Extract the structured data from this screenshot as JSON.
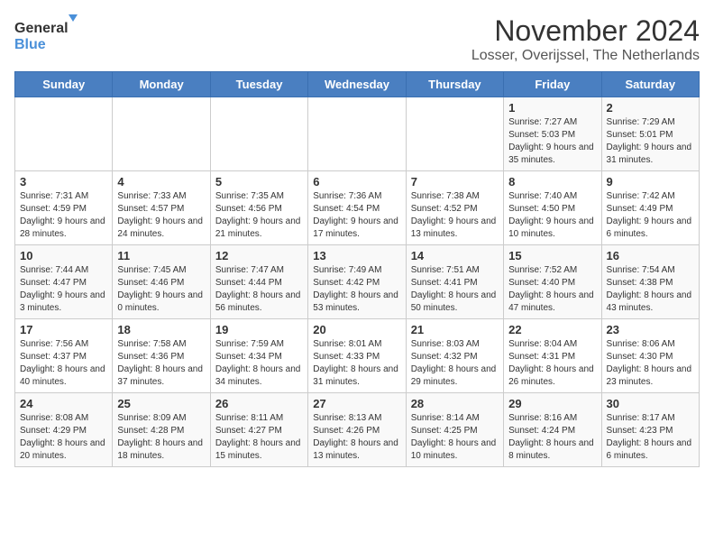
{
  "logo": {
    "line1": "General",
    "line2": "Blue"
  },
  "title": "November 2024",
  "subtitle": "Losser, Overijssel, The Netherlands",
  "headers": [
    "Sunday",
    "Monday",
    "Tuesday",
    "Wednesday",
    "Thursday",
    "Friday",
    "Saturday"
  ],
  "weeks": [
    [
      {
        "day": "",
        "info": ""
      },
      {
        "day": "",
        "info": ""
      },
      {
        "day": "",
        "info": ""
      },
      {
        "day": "",
        "info": ""
      },
      {
        "day": "",
        "info": ""
      },
      {
        "day": "1",
        "info": "Sunrise: 7:27 AM\nSunset: 5:03 PM\nDaylight: 9 hours\nand 35 minutes."
      },
      {
        "day": "2",
        "info": "Sunrise: 7:29 AM\nSunset: 5:01 PM\nDaylight: 9 hours\nand 31 minutes."
      }
    ],
    [
      {
        "day": "3",
        "info": "Sunrise: 7:31 AM\nSunset: 4:59 PM\nDaylight: 9 hours\nand 28 minutes."
      },
      {
        "day": "4",
        "info": "Sunrise: 7:33 AM\nSunset: 4:57 PM\nDaylight: 9 hours\nand 24 minutes."
      },
      {
        "day": "5",
        "info": "Sunrise: 7:35 AM\nSunset: 4:56 PM\nDaylight: 9 hours\nand 21 minutes."
      },
      {
        "day": "6",
        "info": "Sunrise: 7:36 AM\nSunset: 4:54 PM\nDaylight: 9 hours\nand 17 minutes."
      },
      {
        "day": "7",
        "info": "Sunrise: 7:38 AM\nSunset: 4:52 PM\nDaylight: 9 hours\nand 13 minutes."
      },
      {
        "day": "8",
        "info": "Sunrise: 7:40 AM\nSunset: 4:50 PM\nDaylight: 9 hours\nand 10 minutes."
      },
      {
        "day": "9",
        "info": "Sunrise: 7:42 AM\nSunset: 4:49 PM\nDaylight: 9 hours\nand 6 minutes."
      }
    ],
    [
      {
        "day": "10",
        "info": "Sunrise: 7:44 AM\nSunset: 4:47 PM\nDaylight: 9 hours\nand 3 minutes."
      },
      {
        "day": "11",
        "info": "Sunrise: 7:45 AM\nSunset: 4:46 PM\nDaylight: 9 hours\nand 0 minutes."
      },
      {
        "day": "12",
        "info": "Sunrise: 7:47 AM\nSunset: 4:44 PM\nDaylight: 8 hours\nand 56 minutes."
      },
      {
        "day": "13",
        "info": "Sunrise: 7:49 AM\nSunset: 4:42 PM\nDaylight: 8 hours\nand 53 minutes."
      },
      {
        "day": "14",
        "info": "Sunrise: 7:51 AM\nSunset: 4:41 PM\nDaylight: 8 hours\nand 50 minutes."
      },
      {
        "day": "15",
        "info": "Sunrise: 7:52 AM\nSunset: 4:40 PM\nDaylight: 8 hours\nand 47 minutes."
      },
      {
        "day": "16",
        "info": "Sunrise: 7:54 AM\nSunset: 4:38 PM\nDaylight: 8 hours\nand 43 minutes."
      }
    ],
    [
      {
        "day": "17",
        "info": "Sunrise: 7:56 AM\nSunset: 4:37 PM\nDaylight: 8 hours\nand 40 minutes."
      },
      {
        "day": "18",
        "info": "Sunrise: 7:58 AM\nSunset: 4:36 PM\nDaylight: 8 hours\nand 37 minutes."
      },
      {
        "day": "19",
        "info": "Sunrise: 7:59 AM\nSunset: 4:34 PM\nDaylight: 8 hours\nand 34 minutes."
      },
      {
        "day": "20",
        "info": "Sunrise: 8:01 AM\nSunset: 4:33 PM\nDaylight: 8 hours\nand 31 minutes."
      },
      {
        "day": "21",
        "info": "Sunrise: 8:03 AM\nSunset: 4:32 PM\nDaylight: 8 hours\nand 29 minutes."
      },
      {
        "day": "22",
        "info": "Sunrise: 8:04 AM\nSunset: 4:31 PM\nDaylight: 8 hours\nand 26 minutes."
      },
      {
        "day": "23",
        "info": "Sunrise: 8:06 AM\nSunset: 4:30 PM\nDaylight: 8 hours\nand 23 minutes."
      }
    ],
    [
      {
        "day": "24",
        "info": "Sunrise: 8:08 AM\nSunset: 4:29 PM\nDaylight: 8 hours\nand 20 minutes."
      },
      {
        "day": "25",
        "info": "Sunrise: 8:09 AM\nSunset: 4:28 PM\nDaylight: 8 hours\nand 18 minutes."
      },
      {
        "day": "26",
        "info": "Sunrise: 8:11 AM\nSunset: 4:27 PM\nDaylight: 8 hours\nand 15 minutes."
      },
      {
        "day": "27",
        "info": "Sunrise: 8:13 AM\nSunset: 4:26 PM\nDaylight: 8 hours\nand 13 minutes."
      },
      {
        "day": "28",
        "info": "Sunrise: 8:14 AM\nSunset: 4:25 PM\nDaylight: 8 hours\nand 10 minutes."
      },
      {
        "day": "29",
        "info": "Sunrise: 8:16 AM\nSunset: 4:24 PM\nDaylight: 8 hours\nand 8 minutes."
      },
      {
        "day": "30",
        "info": "Sunrise: 8:17 AM\nSunset: 4:23 PM\nDaylight: 8 hours\nand 6 minutes."
      }
    ]
  ]
}
